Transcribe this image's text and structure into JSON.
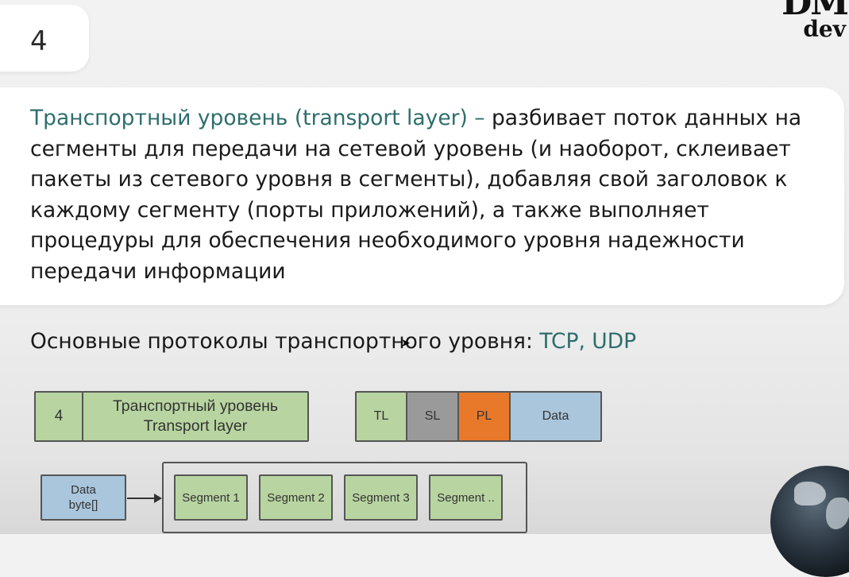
{
  "slide": {
    "number": "4",
    "logo": {
      "top": "DM",
      "bottom": "dev"
    },
    "definition": {
      "term": "Транспортный уровень (transport layer) –",
      "body": " разбивает поток данных на сегменты для передачи на сетевой уровень (и наоборот, склеивает пакеты из сетевого уровня в сегменты), добавляя свой заголовок к каждому сегменту (порты приложений), а также выполняет процедуры для обеспечения необходимого уровня надежности передачи информации"
    },
    "protocols": {
      "label": "Основные протоколы транспортного уровня: ",
      "values": "TCP, UDP"
    }
  },
  "diagram": {
    "layer_number": "4",
    "layer_name_ru": "Транспортный уровень",
    "layer_name_en": "Transport layer",
    "packet": [
      "TL",
      "SL",
      "PL",
      "Data"
    ],
    "source": [
      "Data",
      "byte[]"
    ],
    "segments": [
      "Segment 1",
      "Segment 2",
      "Segment 3",
      "Segment .."
    ],
    "colors": {
      "green": "#b8d5a1",
      "gray": "#9a9a9a",
      "orange": "#e8792a",
      "blue": "#a9c6dc",
      "accent": "#2d6e6c"
    }
  }
}
